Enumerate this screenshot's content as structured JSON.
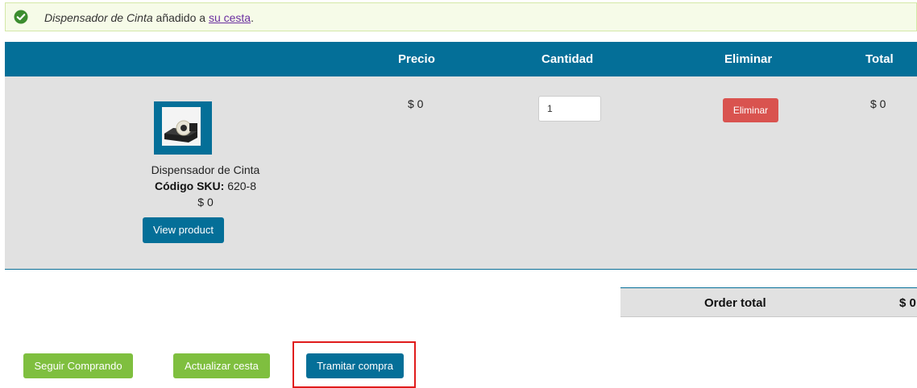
{
  "notice": {
    "product": "Dispensador de Cinta",
    "text_middle": " añadido a ",
    "link_label": "su cesta",
    "suffix": "."
  },
  "table": {
    "headers": {
      "price": "Precio",
      "quantity": "Cantidad",
      "remove": "Eliminar",
      "total": "Total"
    },
    "row": {
      "name": "Dispensador de Cinta",
      "sku_label": "Código SKU:",
      "sku_value": " 620-8",
      "unit_price": "$ 0",
      "view_button": "View product",
      "price": "$ 0",
      "quantity": "1",
      "remove_button": "Eliminar",
      "total": "$ 0"
    }
  },
  "summary": {
    "label": "Order total",
    "value": "$ 0"
  },
  "actions": {
    "continue": "Seguir Comprando",
    "update": "Actualizar cesta",
    "checkout": "Tramitar compra"
  },
  "colors": {
    "header_bg": "#046f98",
    "row_bg": "#e1e1e1",
    "green": "#7fbf3f",
    "red": "#d9534f",
    "highlight": "#e01b1b"
  },
  "icons": {
    "notice": "check-circle-icon",
    "product_image": "tape-dispenser-image"
  }
}
